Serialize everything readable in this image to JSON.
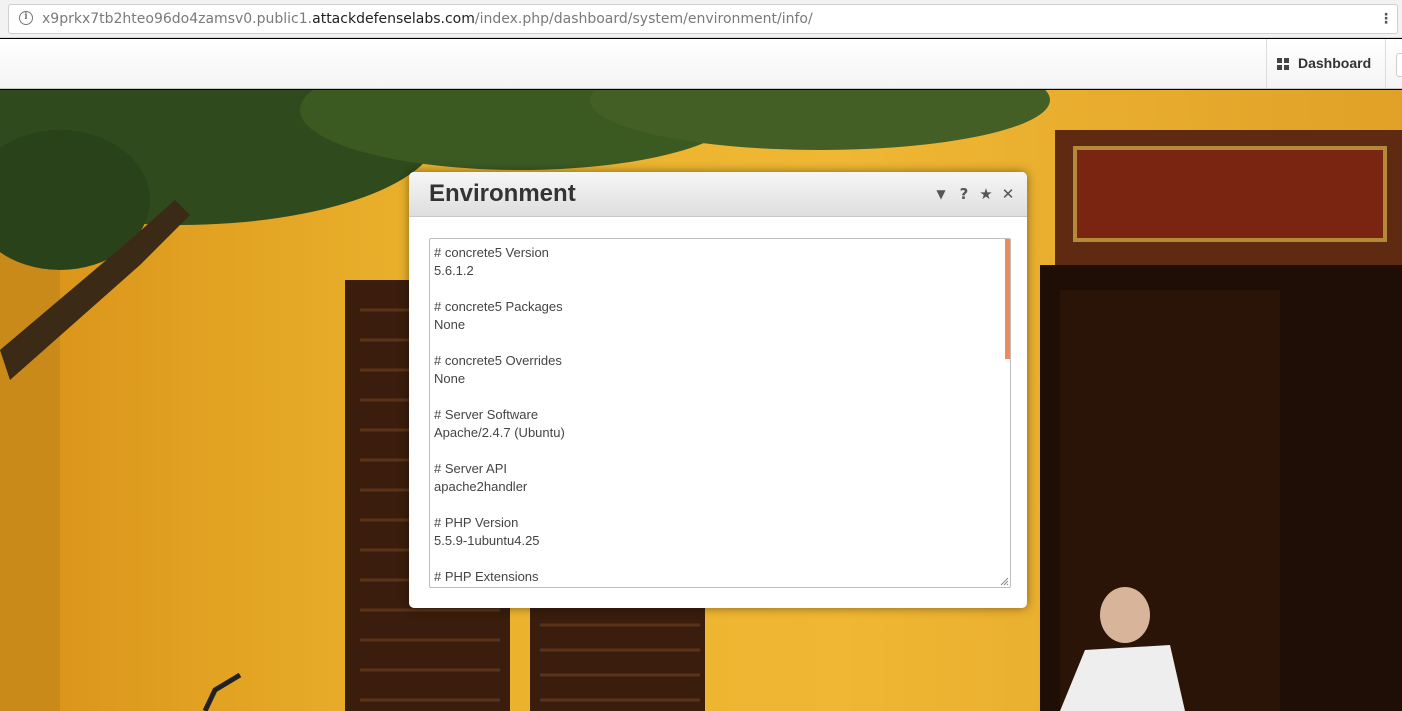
{
  "browser": {
    "url_prefix": "x9prkx7tb2hteo96do4zamsv0.public1.",
    "url_domain": "attackdefenselabs.com",
    "url_path": "/index.php/dashboard/system/environment/info/",
    "info_icon": "info-icon",
    "menu_icon": "more-vertical-icon"
  },
  "toolbar": {
    "dashboard_label": "Dashboard",
    "dashboard_icon": "grid-icon"
  },
  "dialog": {
    "title": "Environment",
    "icons": [
      "chevron-down-icon",
      "help-icon",
      "star-icon",
      "close-icon"
    ],
    "icon_glyphs": [
      "▼",
      "?",
      "★",
      "✕"
    ],
    "accent_color": "#ec8c5e",
    "lines": [
      "# concrete5 Version",
      "5.6.1.2",
      "",
      "# concrete5 Packages",
      "None",
      "",
      "# concrete5 Overrides",
      "None",
      "",
      "# Server Software",
      "Apache/2.4.7 (Ubuntu)",
      "",
      "# Server API",
      "apache2handler",
      "",
      "# PHP Version",
      "5.5.9-1ubuntu4.25",
      "",
      "# PHP Extensions"
    ]
  }
}
